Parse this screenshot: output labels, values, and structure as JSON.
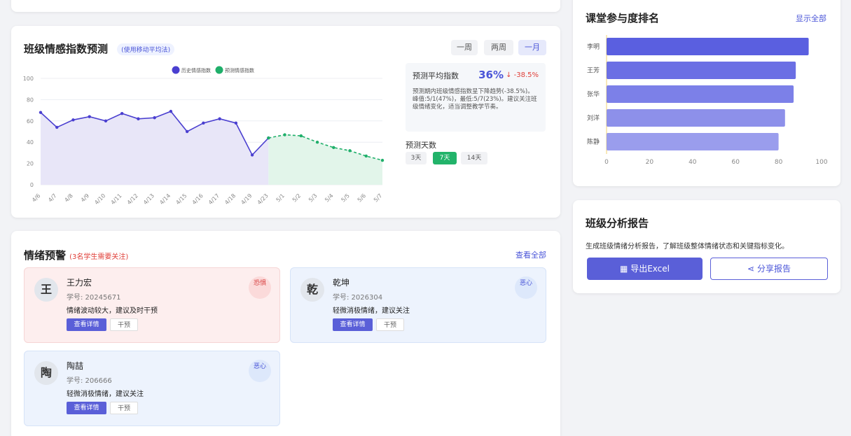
{
  "forecast": {
    "title": "班级情感指数预测",
    "method_tag": "(使用移动平均法)",
    "range_buttons": [
      "一周",
      "两周",
      "一月"
    ],
    "active_range": "一月",
    "legend": [
      "历史情感指数",
      "预测情感指数"
    ],
    "summary_label": "预测平均指数",
    "summary_value": "36%",
    "summary_change": "↓ -38.5%",
    "summary_desc": "预测期内班级情感指数呈下降趋势(-38.5%)。峰值:5/1(47%)，最低:5/7(23%)。建议关注班级情绪变化，适当调整教学节奏。",
    "days_label": "预测天数",
    "days_options": [
      "3天",
      "7天",
      "14天"
    ],
    "active_days": "7天"
  },
  "chart_data": [
    {
      "type": "line",
      "title": "",
      "series": [
        {
          "name": "历史情感指数",
          "color": "#4a3fd0",
          "fill": "#e8e6f8",
          "style": "solid",
          "values": [
            68,
            54,
            61,
            64,
            60,
            67,
            62,
            63,
            69,
            50,
            58,
            62,
            58,
            28,
            44
          ]
        },
        {
          "name": "预测情感指数",
          "color": "#1faf6a",
          "fill": "#e2f5ea",
          "style": "dashed",
          "values": [
            44,
            47,
            46,
            40,
            35,
            32,
            27,
            23
          ]
        }
      ],
      "categories": [
        "4/6",
        "4/7",
        "4/8",
        "4/9",
        "4/10",
        "4/11",
        "4/12",
        "4/13",
        "4/14",
        "4/15",
        "4/16",
        "4/17",
        "4/18",
        "4/19",
        "4/23",
        "5/1",
        "5/2",
        "5/3",
        "5/4",
        "5/5",
        "5/6",
        "5/7"
      ],
      "yticks": [
        0,
        20,
        40,
        60,
        80,
        100
      ],
      "ylim": [
        0,
        100
      ],
      "grid": true,
      "legend_position": "top-center"
    },
    {
      "type": "bar",
      "title": "课堂参与度排名",
      "orientation": "horizontal",
      "categories": [
        "李明",
        "王芳",
        "张华",
        "刘洋",
        "陈静"
      ],
      "values": [
        94,
        88,
        87,
        83,
        80
      ],
      "colors": [
        "#5a5fe0",
        "#6b6fe4",
        "#7c80e8",
        "#8d90ea",
        "#9a9ded"
      ],
      "xticks": [
        0,
        20,
        40,
        60,
        80,
        100
      ],
      "xlim": [
        0,
        100
      ],
      "link": "显示全部"
    }
  ],
  "alerts": {
    "title": "情绪预警",
    "subtitle": "(3名学生需要关注)",
    "view_all": "查看全部",
    "detail_label": "查看详情",
    "intervene_label": "干预",
    "items": [
      {
        "avatar": "王",
        "name": "王力宏",
        "id": "学号: 20245671",
        "msg": "情绪波动较大，建议及时干预",
        "emotion": "恐惧",
        "tone": "red"
      },
      {
        "avatar": "乾",
        "name": "乾坤",
        "id": "学号: 2026304",
        "msg": "轻微消极情绪，建议关注",
        "emotion": "恶心",
        "tone": "blue"
      },
      {
        "avatar": "陶",
        "name": "陶喆",
        "id": "学号: 206666",
        "msg": "轻微消极情绪，建议关注",
        "emotion": "恶心",
        "tone": "blue"
      }
    ]
  },
  "report": {
    "title": "班级分析报告",
    "desc": "生成班级情绪分析报告，了解班级整体情绪状态和关键指标变化。",
    "excel_label": "导出Excel",
    "share_label": "分享报告"
  },
  "colors": {
    "accent": "#5a5fd8",
    "green": "#22b36a",
    "red": "#e0403a"
  }
}
